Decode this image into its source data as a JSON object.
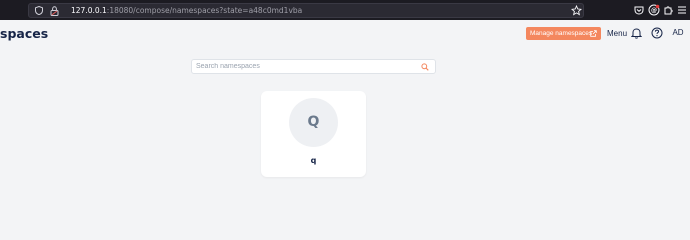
{
  "browser": {
    "url_host": "127.0.0.1",
    "url_path": ":18080/compose/namespaces?state=a48c0md1vba"
  },
  "header": {
    "title": "spaces",
    "manage_button_label": "Manage namespaces",
    "menu_label": "Menu",
    "avatar_initials": "AD"
  },
  "search": {
    "placeholder": "Search namespaces"
  },
  "namespaces": [
    {
      "initial": "Q",
      "name": "q"
    }
  ],
  "colors": {
    "accent": "#f4875e",
    "title": "#162447",
    "background": "#f3f4f6"
  },
  "icons": [
    "shield-icon",
    "lock-icon",
    "bookmark-star-icon",
    "pocket-icon",
    "extension-icon",
    "menu-icon",
    "external-link-icon",
    "bell-icon",
    "help-icon",
    "search-icon"
  ]
}
